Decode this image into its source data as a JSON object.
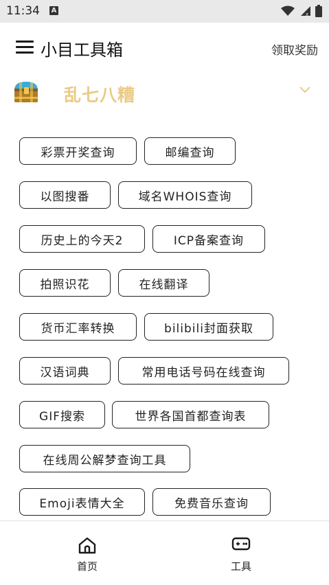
{
  "status_bar": {
    "time": "11:34",
    "notification_badge": "A"
  },
  "header": {
    "title": "小目工具箱",
    "reward_label": "领取奖励"
  },
  "category": {
    "title": "乱七八糟",
    "accent_color": "#eacb86"
  },
  "tools": [
    "彩票开奖查询",
    "邮编查询",
    "以图搜番",
    "域名WHOIS查询",
    "历史上的今天2",
    "ICP备案查询",
    "拍照识花",
    "在线翻译",
    "货币汇率转换",
    "bilibili封面获取",
    "汉语词典",
    "常用电话号码在线查询",
    "GIF搜索",
    "世界各国首都查询表",
    "在线周公解梦查询工具",
    "Emoji表情大全",
    "免费音乐查询"
  ],
  "bottom_nav": {
    "home_label": "首页",
    "tools_label": "工具"
  }
}
